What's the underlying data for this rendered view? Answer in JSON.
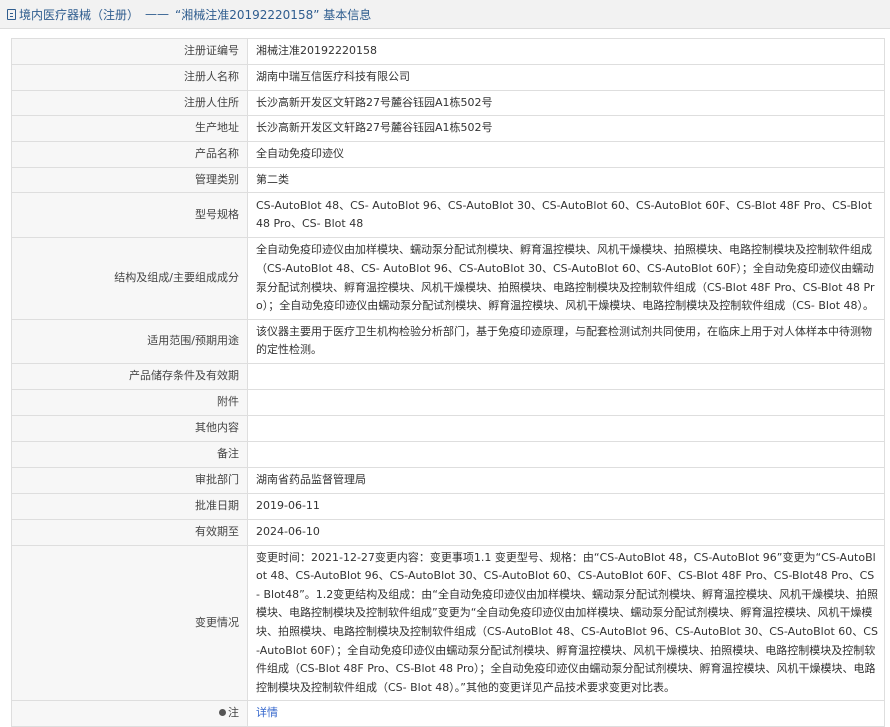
{
  "header": {
    "prefix": "境内医疗器械（注册）",
    "separator": "——",
    "title": "“湘械注准20192220158”  基本信息"
  },
  "rows": [
    {
      "label": "注册证编号",
      "value": "湘械注准20192220158"
    },
    {
      "label": "注册人名称",
      "value": "湖南中瑞互信医疗科技有限公司"
    },
    {
      "label": "注册人住所",
      "value": "长沙高新开发区文轩路27号麓谷钰园A1栋502号"
    },
    {
      "label": "生产地址",
      "value": "长沙高新开发区文轩路27号麓谷钰园A1栋502号"
    },
    {
      "label": "产品名称",
      "value": "全自动免疫印迹仪"
    },
    {
      "label": "管理类别",
      "value": "第二类"
    },
    {
      "label": "型号规格",
      "value": "CS-AutoBlot 48、CS- AutoBlot 96、CS-AutoBlot 30、CS-AutoBlot 60、CS-AutoBlot 60F、CS-Blot 48F Pro、CS-Blot 48 Pro、CS- Blot 48"
    },
    {
      "label": "结构及组成/主要组成成分",
      "value": "全自动免疫印迹仪由加样模块、蠕动泵分配试剂模块、孵育温控模块、风机干燥模块、拍照模块、电路控制模块及控制软件组成（CS-AutoBlot 48、CS- AutoBlot 96、CS-AutoBlot 30、CS-AutoBlot 60、CS-AutoBlot 60F）；全自动免疫印迹仪由蠕动泵分配试剂模块、孵育温控模块、风机干燥模块、拍照模块、电路控制模块及控制软件组成（CS-Blot 48F Pro、CS-Blot 48 Pro）；全自动免疫印迹仪由蠕动泵分配试剂模块、孵育温控模块、风机干燥模块、电路控制模块及控制软件组成（CS- Blot 48）。"
    },
    {
      "label": "适用范围/预期用途",
      "value": "该仪器主要用于医疗卫生机构检验分析部门，基于免疫印迹原理，与配套检测试剂共同使用，在临床上用于对人体样本中待测物的定性检测。"
    },
    {
      "label": "产品储存条件及有效期",
      "value": ""
    },
    {
      "label": "附件",
      "value": ""
    },
    {
      "label": "其他内容",
      "value": ""
    },
    {
      "label": "备注",
      "value": ""
    },
    {
      "label": "审批部门",
      "value": "湖南省药品监督管理局"
    },
    {
      "label": "批准日期",
      "value": "2019-06-11"
    },
    {
      "label": "有效期至",
      "value": "2024-06-10"
    },
    {
      "label": "变更情况",
      "value": "变更时间：2021-12-27变更内容：变更事项1.1 变更型号、规格：由“CS-AutoBlot 48，CS-AutoBlot 96”变更为“CS-AutoBlot 48、CS-AutoBlot 96、CS-AutoBlot 30、CS-AutoBlot 60、CS-AutoBlot 60F、CS-Blot 48F Pro、CS-Blot48 Pro、CS- Blot48”。1.2变更结构及组成：由“全自动免疫印迹仪由加样模块、蠕动泵分配试剂模块、孵育温控模块、风机干燥模块、拍照模块、电路控制模块及控制软件组成”变更为“全自动免疫印迹仪由加样模块、蠕动泵分配试剂模块、孵育温控模块、风机干燥模块、拍照模块、电路控制模块及控制软件组成（CS-AutoBlot 48、CS-AutoBlot 96、CS-AutoBlot 30、CS-AutoBlot 60、CS-AutoBlot 60F）；全自动免疫印迹仪由蠕动泵分配试剂模块、孵育温控模块、风机干燥模块、拍照模块、电路控制模块及控制软件组成（CS-Blot 48F Pro、CS-Blot 48 Pro）；全自动免疫印迹仪由蠕动泵分配试剂模块、孵育温控模块、风机干燥模块、电路控制模块及控制软件组成（CS- Blot 48）。”其他的变更详见产品技术要求变更对比表。"
    }
  ],
  "note": {
    "label": "注",
    "link_text": "详情"
  }
}
